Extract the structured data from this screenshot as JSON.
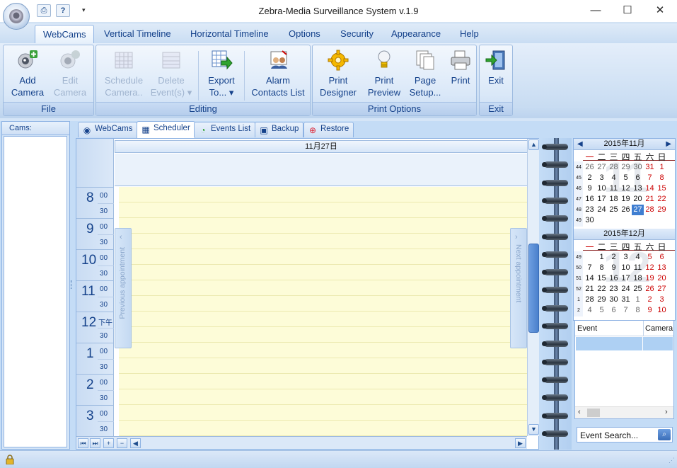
{
  "window": {
    "title": "Zebra-Media Surveillance System v.1.9"
  },
  "quick_access": {
    "print_icon": "printer-icon",
    "help_icon": "help-icon",
    "dropdown": "▾"
  },
  "window_controls": {
    "minimize": "—",
    "maximize": "☐",
    "close": "✕"
  },
  "ribbon_tabs": [
    "WebCams",
    "Vertical Timeline",
    "Horizontal Timeline",
    "Options",
    "Security",
    "Appearance",
    "Help"
  ],
  "groups": {
    "file": {
      "label": "File",
      "add_camera": "Add\nCamera",
      "edit_camera": "Edit\nCamera"
    },
    "editing": {
      "label": "Editing",
      "schedule_camera": "Schedule\nCamera..",
      "delete_events": "Delete\nEvent(s) ▾",
      "export_to": "Export\nTo... ▾",
      "alarm_contacts": "Alarm\nContacts List"
    },
    "print_options": {
      "label": "Print Options",
      "print_designer": "Print\nDesigner",
      "print_preview": "Print\nPreview",
      "page_setup": "Page\nSetup...",
      "print": "Print"
    },
    "exit": {
      "label": "Exit",
      "exit": "Exit"
    }
  },
  "cams_panel": {
    "header": "Cams:"
  },
  "main_tabs": [
    "WebCams",
    "Scheduler",
    "Events List",
    "Backup",
    "Restore"
  ],
  "scheduler": {
    "day_header": "11月27日",
    "hours": [
      {
        "h": "8",
        "m0": "00",
        "m30": "30"
      },
      {
        "h": "9",
        "m0": "00",
        "m30": "30"
      },
      {
        "h": "10",
        "m0": "00",
        "m30": "30"
      },
      {
        "h": "11",
        "m0": "00",
        "m30": "30"
      },
      {
        "h": "12",
        "m0": "下午",
        "m30": "30"
      },
      {
        "h": "1",
        "m0": "00",
        "m30": "30"
      },
      {
        "h": "2",
        "m0": "00",
        "m30": "30"
      },
      {
        "h": "3",
        "m0": "00",
        "m30": "30"
      }
    ],
    "previous_appointment": "Previous appointment",
    "next_appointment": "Next appointment"
  },
  "calendar": {
    "weekday_names": [
      "一",
      "二",
      "三",
      "四",
      "五",
      "六",
      "日"
    ],
    "months": [
      {
        "title": "2015年11月",
        "watermark": "11",
        "weeks": [
          "44",
          "45",
          "46",
          "47",
          "48",
          "49"
        ],
        "days": [
          [
            "26",
            "27",
            "28",
            "29",
            "30",
            "31",
            "1"
          ],
          [
            "2",
            "3",
            "4",
            "5",
            "6",
            "7",
            "8"
          ],
          [
            "9",
            "10",
            "11",
            "12",
            "13",
            "14",
            "15"
          ],
          [
            "16",
            "17",
            "18",
            "19",
            "20",
            "21",
            "22"
          ],
          [
            "23",
            "24",
            "25",
            "26",
            "27",
            "28",
            "29"
          ],
          [
            "30",
            "",
            "",
            "",
            "",
            "",
            ""
          ]
        ]
      },
      {
        "title": "2015年12月",
        "watermark": "12",
        "weeks": [
          "49",
          "50",
          "51",
          "52",
          "1",
          "2"
        ],
        "days": [
          [
            "",
            "1",
            "2",
            "3",
            "4",
            "5",
            "6"
          ],
          [
            "7",
            "8",
            "9",
            "10",
            "11",
            "12",
            "13"
          ],
          [
            "14",
            "15",
            "16",
            "17",
            "18",
            "19",
            "20"
          ],
          [
            "21",
            "22",
            "23",
            "24",
            "25",
            "26",
            "27"
          ],
          [
            "28",
            "29",
            "30",
            "31",
            "1",
            "2",
            "3"
          ],
          [
            "4",
            "5",
            "6",
            "7",
            "8",
            "9",
            "10"
          ]
        ]
      }
    ],
    "today": "27"
  },
  "events_panel": {
    "col_event": "Event",
    "col_camera": "Camera",
    "search_placeholder": "Event Search..."
  },
  "status_bar": {
    "lock_icon": "lock-icon"
  }
}
